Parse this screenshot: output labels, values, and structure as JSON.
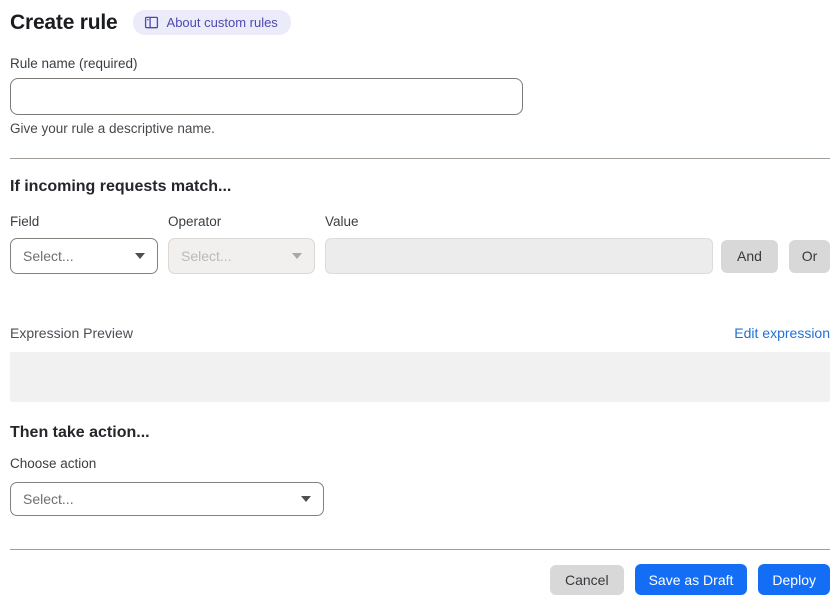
{
  "header": {
    "title": "Create rule",
    "about_badge_label": "About custom rules"
  },
  "rule_name": {
    "label": "Rule name (required)",
    "value": "",
    "helper": "Give your rule a descriptive name."
  },
  "match_section": {
    "heading": "If incoming requests match...",
    "field": {
      "label": "Field",
      "selected": "Select..."
    },
    "operator": {
      "label": "Operator",
      "selected": "Select..."
    },
    "value": {
      "label": "Value",
      "value": ""
    },
    "and_button": "And",
    "or_button": "Or"
  },
  "expression": {
    "preview_label": "Expression Preview",
    "edit_link": "Edit expression",
    "content": ""
  },
  "action_section": {
    "heading": "Then take action...",
    "choose_label": "Choose action",
    "selected": "Select..."
  },
  "footer": {
    "cancel": "Cancel",
    "save_draft": "Save as Draft",
    "deploy": "Deploy"
  },
  "colors": {
    "primary_blue": "#146ef5",
    "link_blue": "#2171d6",
    "badge_bg": "#ecebfa",
    "badge_text": "#4d49ae",
    "disabled_bg": "#f1f0ef",
    "neutral_button_bg": "#d8d8d8"
  }
}
